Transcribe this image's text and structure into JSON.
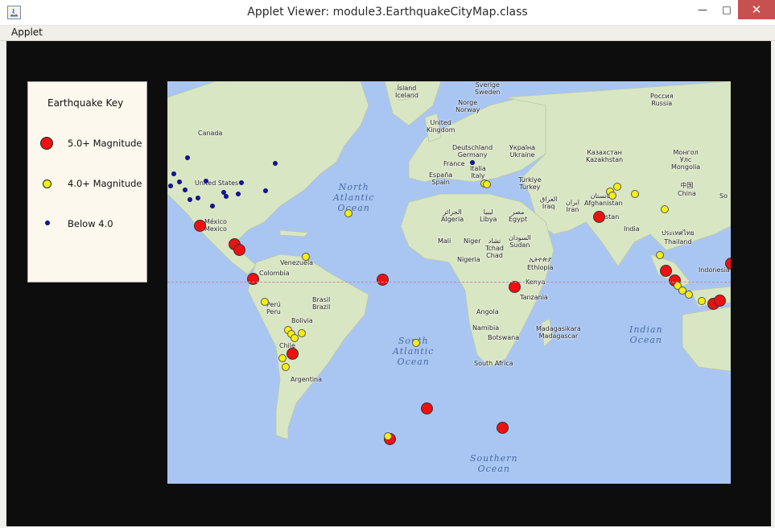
{
  "window": {
    "title": "Applet Viewer: module3.EarthquakeCityMap.class",
    "min_glyph": "—",
    "max_glyph": "□",
    "close_glyph": "✕"
  },
  "menu": {
    "applet_label": "Applet"
  },
  "key": {
    "title": "Earthquake Key",
    "items": [
      {
        "label": "5.0+ Magnitude",
        "color": "#ef1010"
      },
      {
        "label": "4.0+ Magnitude",
        "color": "#f7ee12"
      },
      {
        "label": "Below 4.0",
        "color": "#1414b8"
      }
    ]
  },
  "map": {
    "ocean_color": "#a9c6f3",
    "land_color": "#d9e6c4",
    "place_labels": {
      "iceland": "Ísland\nIceland",
      "sverige": "Sverige\nSweden",
      "norge": "Norge\nNorway",
      "russia": "Россия\nRussia",
      "uk": "United\nKingdom",
      "canada": "Canada",
      "germany": "Deutschland\nGermany",
      "ukraine": "Україна\nUkraine",
      "france": "France",
      "italy": "Italia\nItaly",
      "spain": "España\nSpain",
      "kazakhstan": "Казахстан\nKazakhstan",
      "mongolia": "Монгол\nУлс\nMongolia",
      "turkey": "Türkiye\nTurkey",
      "china": "中国\nChina",
      "us": "United States",
      "iraq": "العراق\nIraq",
      "iran": "ایران\nIran",
      "afghanistan": "افغانستان\nAfghanistan",
      "pakistan": "stan",
      "algeria": "الجزائر\nAlgeria",
      "libya": "ليبيا\nLibya",
      "egypt": "مصر\nEgypt",
      "india": "India",
      "thailand": "ประเทศไทย\nThailand",
      "mexico": "México\nMexico",
      "mali": "Mali",
      "niger": "Niger",
      "chad": "تشاد\nTchad\nChad",
      "sudan": "السودان\nSudan",
      "nigeria": "Nigeria",
      "ethiopia": "ኢትዮጵያ\nEthiopia",
      "venezuela": "Venezuela",
      "colombia": "Colombia",
      "kenya": "Kenya",
      "tanzania": "Tanzania",
      "indonesia": "Indonesia",
      "peru": "Perú\nPeru",
      "brasil": "Brasil\nBrazil",
      "angola": "Angola",
      "bolivia": "Bolivia",
      "namibia": "Namibia",
      "madagascar": "Madagasikara\nMadagascar",
      "botswana": "Botswana",
      "chile": "Chile",
      "southafrica": "South Africa",
      "argentina": "Argentina",
      "so": "So"
    },
    "ocean_labels": {
      "north_atlantic": "North\nAtlantic\nOcean",
      "south_atlantic": "South\nAtlantic\nOcean",
      "indian": "Indian\nOcean",
      "southern": "Southern\nOcean"
    }
  }
}
